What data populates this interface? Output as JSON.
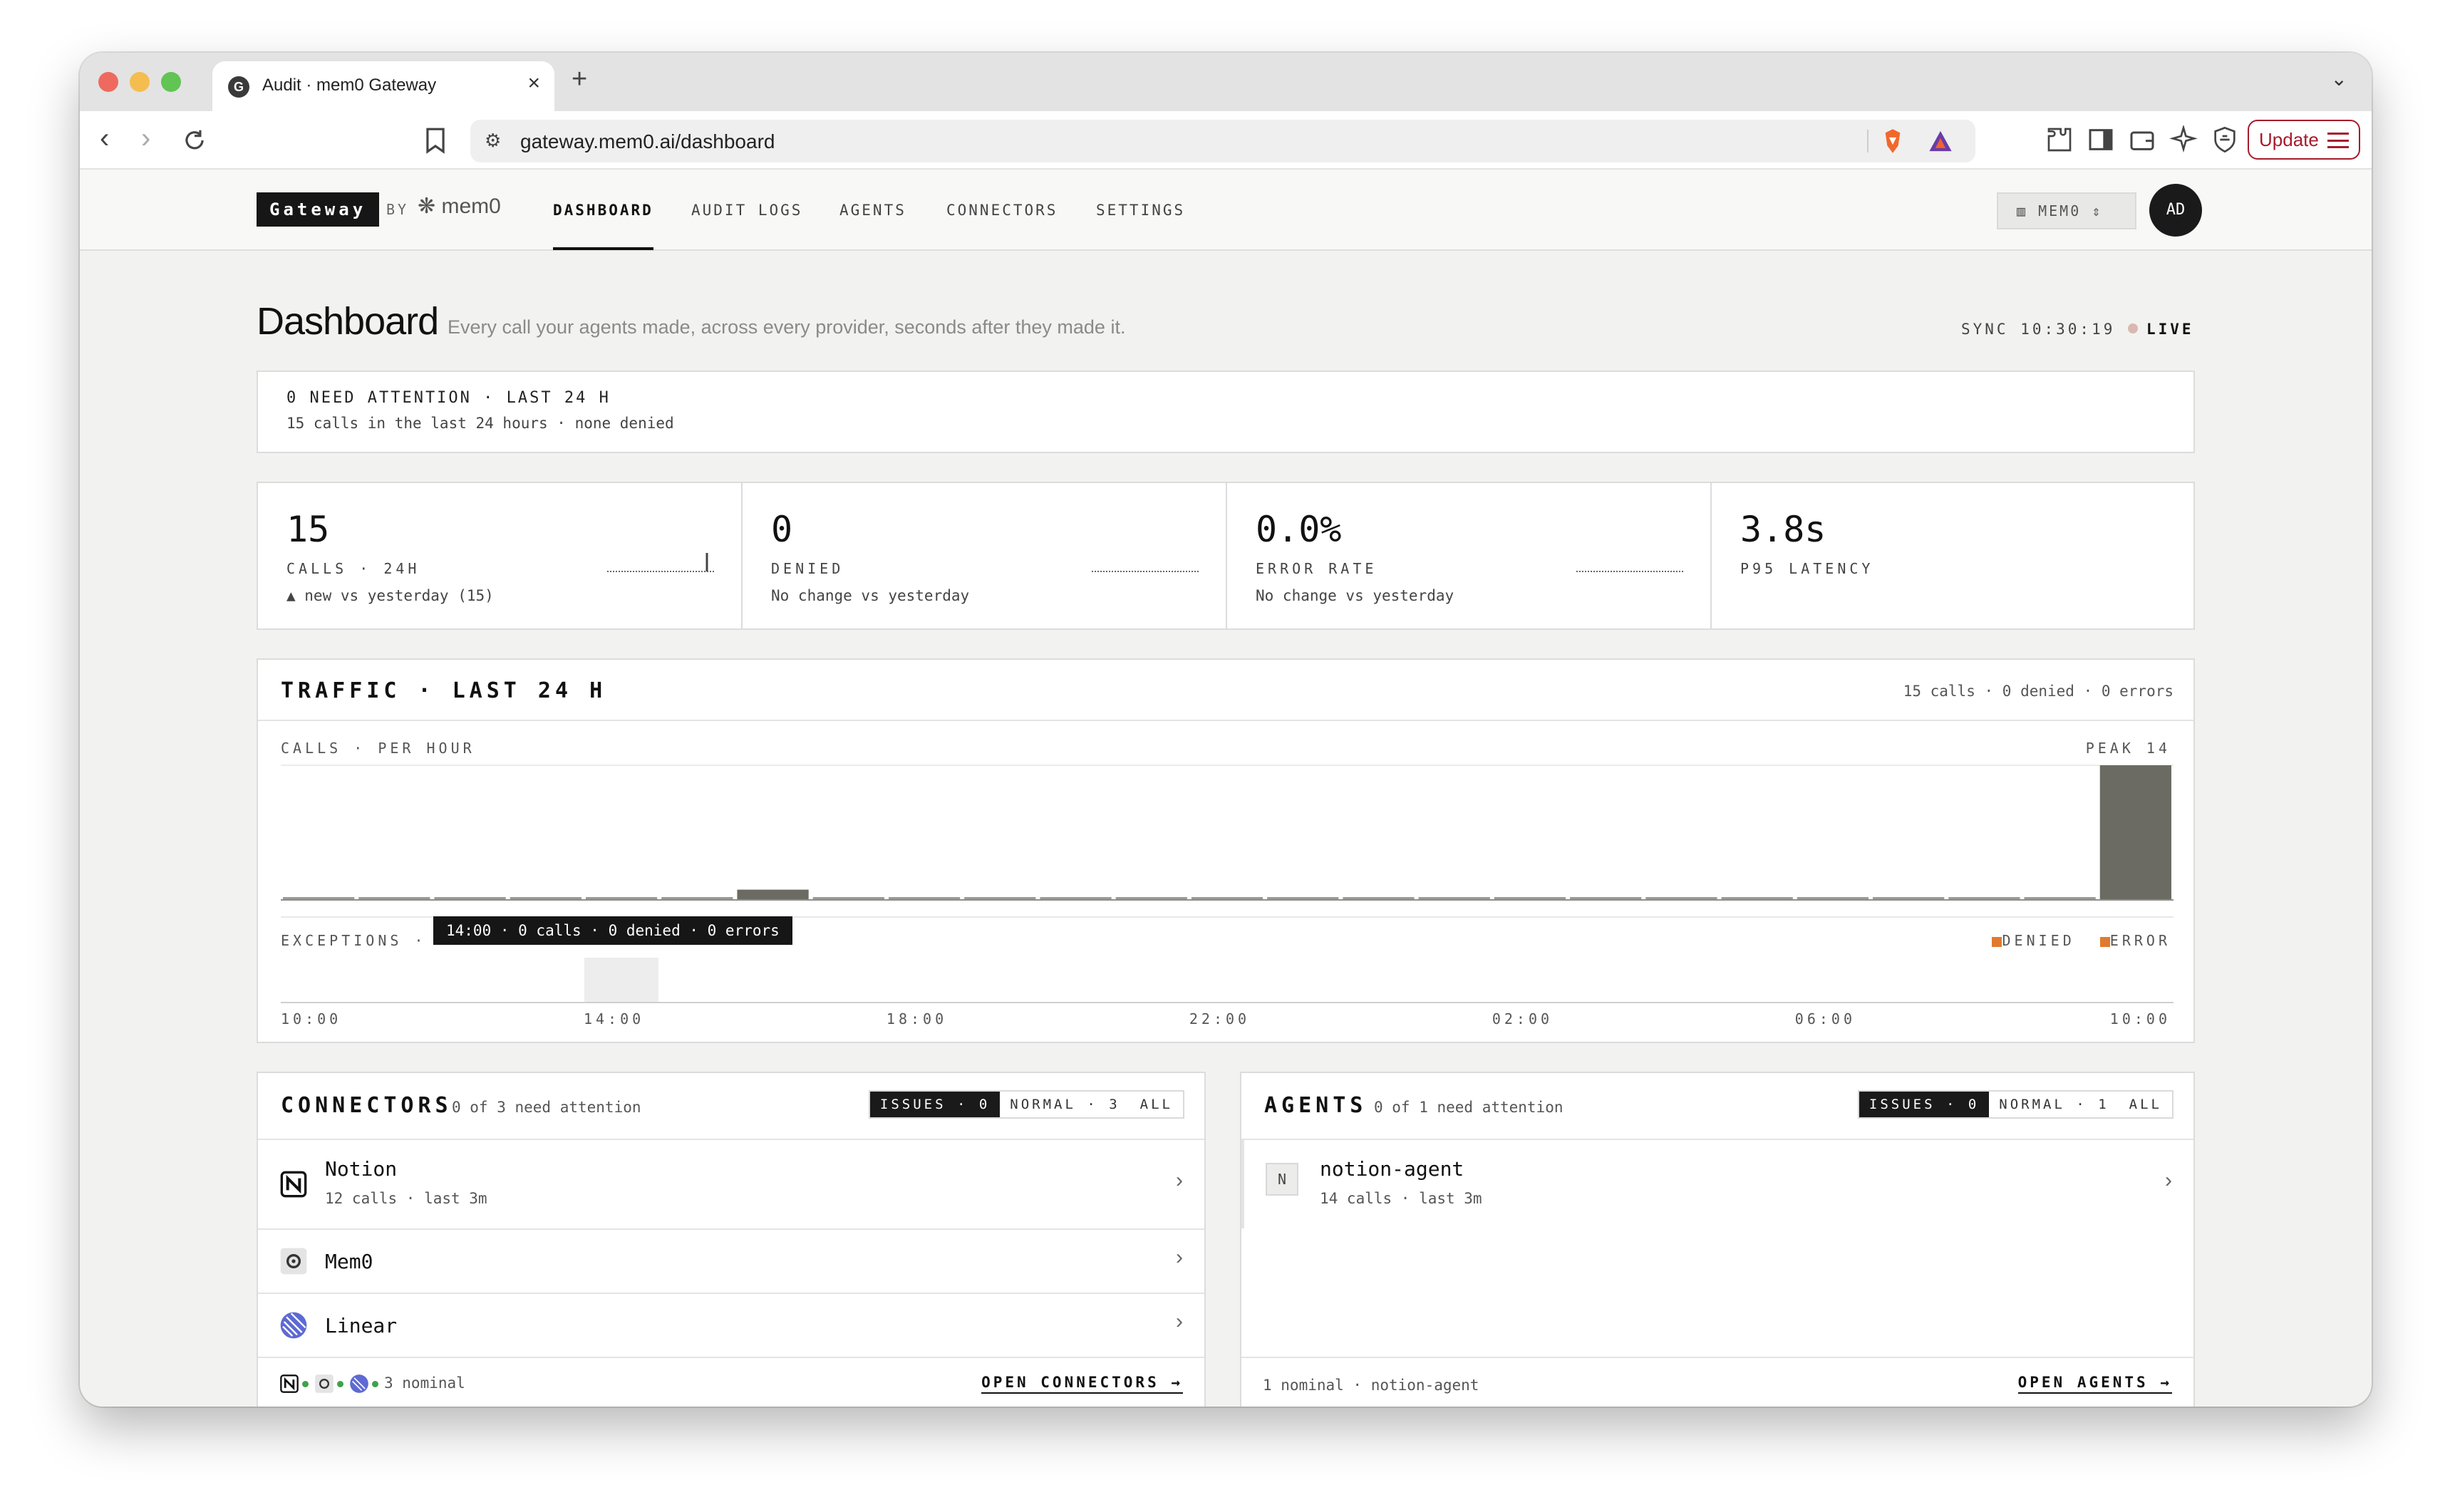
{
  "browser": {
    "tab_title": "Audit · mem0 Gateway",
    "url": "gateway.mem0.ai/dashboard",
    "update_label": "Update"
  },
  "nav": {
    "brand": "Gateway",
    "by": "BY",
    "logo_text": "mem0",
    "links": [
      "DASHBOARD",
      "AUDIT LOGS",
      "AGENTS",
      "CONNECTORS",
      "SETTINGS"
    ],
    "active": "DASHBOARD",
    "org": "MEM0",
    "avatar": "AD"
  },
  "header": {
    "title": "Dashboard",
    "subtitle": "Every call your agents made, across every provider, seconds after they made it.",
    "sync": "SYNC 10:30:19",
    "live": "LIVE"
  },
  "attention": {
    "title": "0 NEED ATTENTION · LAST 24 H",
    "sub": "15 calls in the last 24 hours · none denied"
  },
  "stats": [
    {
      "value": "15",
      "label": "CALLS · 24H",
      "note": "▲ new vs yesterday (15)"
    },
    {
      "value": "0",
      "label": "DENIED",
      "note": "No change vs yesterday"
    },
    {
      "value": "0.0%",
      "label": "ERROR RATE",
      "note": "No change vs yesterday"
    },
    {
      "value": "3.8s",
      "label": "P95 LATENCY",
      "note": ""
    }
  ],
  "traffic": {
    "title": "TRAFFIC · LAST 24 H",
    "summary": "15 calls · 0 denied · 0 errors",
    "calls_label": "CALLS · PER HOUR",
    "peak": "PEAK 14",
    "exceptions_label": "EXCEPTIONS ·",
    "legend": [
      "DENIED",
      "ERROR"
    ],
    "tooltip": "14:00 · 0 calls · 0 denied · 0 errors",
    "x_labels": [
      "10:00",
      "14:00",
      "18:00",
      "22:00",
      "02:00",
      "06:00",
      "10:00"
    ]
  },
  "chart_data": {
    "type": "bar",
    "title": "TRAFFIC · LAST 24 H",
    "ylabel": "CALLS · PER HOUR",
    "categories": [
      "10:00",
      "11:00",
      "12:00",
      "13:00",
      "14:00",
      "15:00",
      "16:00",
      "17:00",
      "18:00",
      "19:00",
      "20:00",
      "21:00",
      "22:00",
      "23:00",
      "00:00",
      "01:00",
      "02:00",
      "03:00",
      "04:00",
      "05:00",
      "06:00",
      "07:00",
      "08:00",
      "09:00",
      "10:00"
    ],
    "series": [
      {
        "name": "calls",
        "values": [
          0,
          0,
          0,
          0,
          0,
          0,
          1,
          0,
          0,
          0,
          0,
          0,
          0,
          0,
          0,
          0,
          0,
          0,
          0,
          0,
          0,
          0,
          0,
          0,
          14
        ]
      }
    ],
    "ylim": [
      0,
      14
    ],
    "colors": {
      "calls": "#6b6b63",
      "denied": "#e07a2e",
      "error": "#e07a2e"
    }
  },
  "connectors": {
    "title": "CONNECTORS",
    "sub": "0 of 3 need attention",
    "filters": [
      "ISSUES · 0",
      "NORMAL · 3",
      "ALL"
    ],
    "items": [
      {
        "name": "Notion",
        "meta": "12 calls · last 3m",
        "icon": "notion-icon"
      },
      {
        "name": "Mem0",
        "meta": "",
        "icon": "mem0-icon"
      },
      {
        "name": "Linear",
        "meta": "",
        "icon": "linear-icon"
      }
    ],
    "footer_status": "3 nominal",
    "footer_link": "OPEN CONNECTORS →"
  },
  "agents": {
    "title": "AGENTS",
    "sub": "0 of 1 need attention",
    "filters": [
      "ISSUES · 0",
      "NORMAL · 1",
      "ALL"
    ],
    "items": [
      {
        "badge": "N",
        "name": "notion-agent",
        "meta": "14 calls · last 3m"
      }
    ],
    "footer_status": "1 nominal · notion-agent",
    "footer_link": "OPEN AGENTS →"
  }
}
